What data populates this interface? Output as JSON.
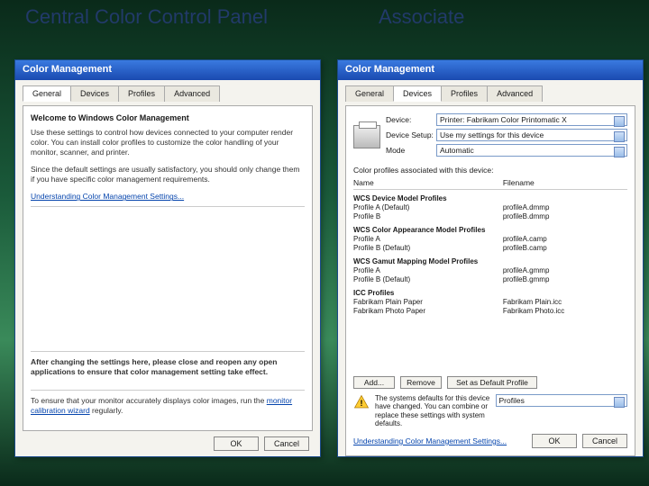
{
  "slide": {
    "left_title": "Central Color Control Panel",
    "right_title": "Associate"
  },
  "window_title": "Color Management",
  "tabs": [
    "General",
    "Devices",
    "Profiles",
    "Advanced"
  ],
  "left_panel": {
    "active_tab": "General",
    "welcome": "Welcome to Windows Color Management",
    "p1": "Use these settings to control how devices connected to your computer render color. You can install color profiles to customize the color handling of your monitor, scanner, and printer.",
    "p2": "Since the default settings are usually satisfactory, you should only change them if you have specific color management requirements.",
    "link": "Understanding Color Management Settings...",
    "warn": "After changing the settings here, please close and reopen any open applications to ensure that color management setting take effect.",
    "p3a": "To ensure that your monitor accurately displays color images, run the ",
    "p3_link": "monitor calibration wizard",
    "p3b": " regularly.",
    "ok": "OK",
    "cancel": "Cancel"
  },
  "right_panel": {
    "active_tab": "Devices",
    "device_label": "Device:",
    "device_value": "Printer: Fabrikam Color Printomatic X",
    "setup_label": "Device Setup:",
    "setup_value": "Use my settings for this device",
    "mode_label": "Mode",
    "mode_value": "Automatic",
    "assoc_note": "Color profiles associated with this device:",
    "col_name": "Name",
    "col_file": "Filename",
    "groups": [
      {
        "title": "WCS Device Model Profiles",
        "items": [
          {
            "n": "Profile A (Default)",
            "f": "profileA.dmmp"
          },
          {
            "n": "Profile B",
            "f": "profileB.dmmp"
          }
        ]
      },
      {
        "title": "WCS Color Appearance Model Profiles",
        "items": [
          {
            "n": "Profile A",
            "f": "profileA.camp"
          },
          {
            "n": "Profile B (Default)",
            "f": "profileB.camp"
          }
        ]
      },
      {
        "title": "WCS Gamut Mapping Model Profiles",
        "items": [
          {
            "n": "Profile A",
            "f": "profileA.gmmp"
          },
          {
            "n": "Profile B (Default)",
            "f": "profileB.gmmp"
          }
        ]
      },
      {
        "title": "ICC Profiles",
        "items": [
          {
            "n": "Fabrikam Plain Paper",
            "f": "Fabrikam Plain.icc"
          },
          {
            "n": "Fabrikam Photo Paper",
            "f": "Fabrikam Photo.icc"
          }
        ]
      }
    ],
    "add": "Add...",
    "remove": "Remove",
    "setdefault": "Set as Default Profile",
    "warn": "The systems defaults for this device have changed. You can combine or replace these settings with system defaults.",
    "profiles_btn": "Profiles",
    "link": "Understanding Color Management Settings...",
    "ok": "OK",
    "cancel": "Cancel"
  }
}
